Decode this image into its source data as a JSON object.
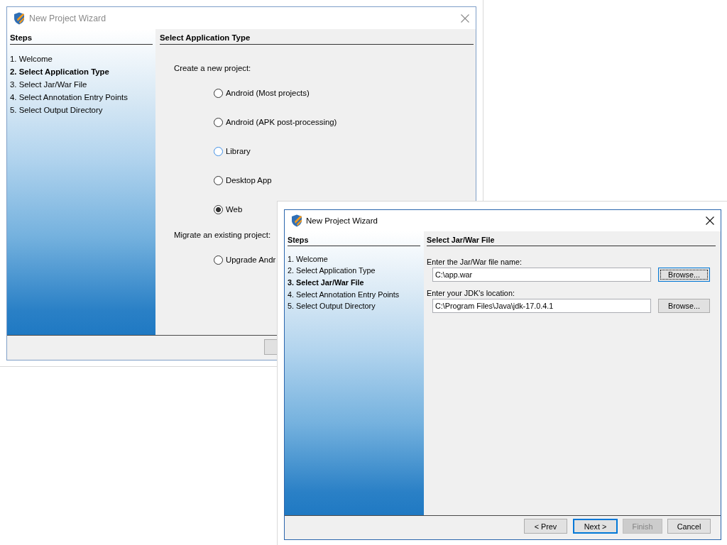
{
  "windows": [
    {
      "kind": "application_type",
      "active": false,
      "title": "New Project Wizard",
      "sidebar": {
        "heading": "Steps",
        "steps": [
          {
            "label": "1. Welcome",
            "selected": false
          },
          {
            "label": "2. Select Application Type",
            "selected": true
          },
          {
            "label": "3. Select Jar/War File",
            "selected": false
          },
          {
            "label": "4. Select Annotation Entry Points",
            "selected": false
          },
          {
            "label": "5. Select Output Directory",
            "selected": false
          }
        ]
      },
      "panel": {
        "heading": "Select Application Type",
        "groups": [
          {
            "label": "Create a new project:",
            "options": [
              {
                "label": "Android (Most projects)",
                "selected": false,
                "hovered": false
              },
              {
                "label": "Android (APK post-processing)",
                "selected": false,
                "hovered": false
              },
              {
                "label": "Library",
                "selected": false,
                "hovered": true
              },
              {
                "label": "Desktop App",
                "selected": false,
                "hovered": false
              },
              {
                "label": "Web",
                "selected": true,
                "hovered": false
              }
            ]
          },
          {
            "label": "Migrate an existing project:",
            "options": [
              {
                "label": "Upgrade Andr",
                "selected": false,
                "hovered": false
              }
            ]
          }
        ]
      }
    },
    {
      "kind": "jar_file",
      "active": true,
      "title": "New Project Wizard",
      "sidebar": {
        "heading": "Steps",
        "steps": [
          {
            "label": "1. Welcome",
            "selected": false
          },
          {
            "label": "2. Select Application Type",
            "selected": false
          },
          {
            "label": "3. Select Jar/War File",
            "selected": true
          },
          {
            "label": "4. Select Annotation Entry Points",
            "selected": false
          },
          {
            "label": "5. Select Output Directory",
            "selected": false
          }
        ]
      },
      "panel": {
        "heading": "Select Jar/War File",
        "fields": [
          {
            "label": "Enter the Jar/War file name:",
            "value": "C:\\app.war",
            "button": {
              "label": "Browse...",
              "focused": true
            }
          },
          {
            "label": "Enter your JDK's location:",
            "value": "C:\\Program Files\\Java\\jdk-17.0.4.1",
            "button": {
              "label": "Browse...",
              "focused": false
            }
          }
        ]
      },
      "buttons": [
        {
          "label": "< Prev",
          "default": false,
          "disabled": false
        },
        {
          "label": "Next >",
          "default": true,
          "disabled": false
        },
        {
          "label": "Finish",
          "default": false,
          "disabled": true
        },
        {
          "label": "Cancel",
          "default": false,
          "disabled": false
        }
      ]
    }
  ]
}
